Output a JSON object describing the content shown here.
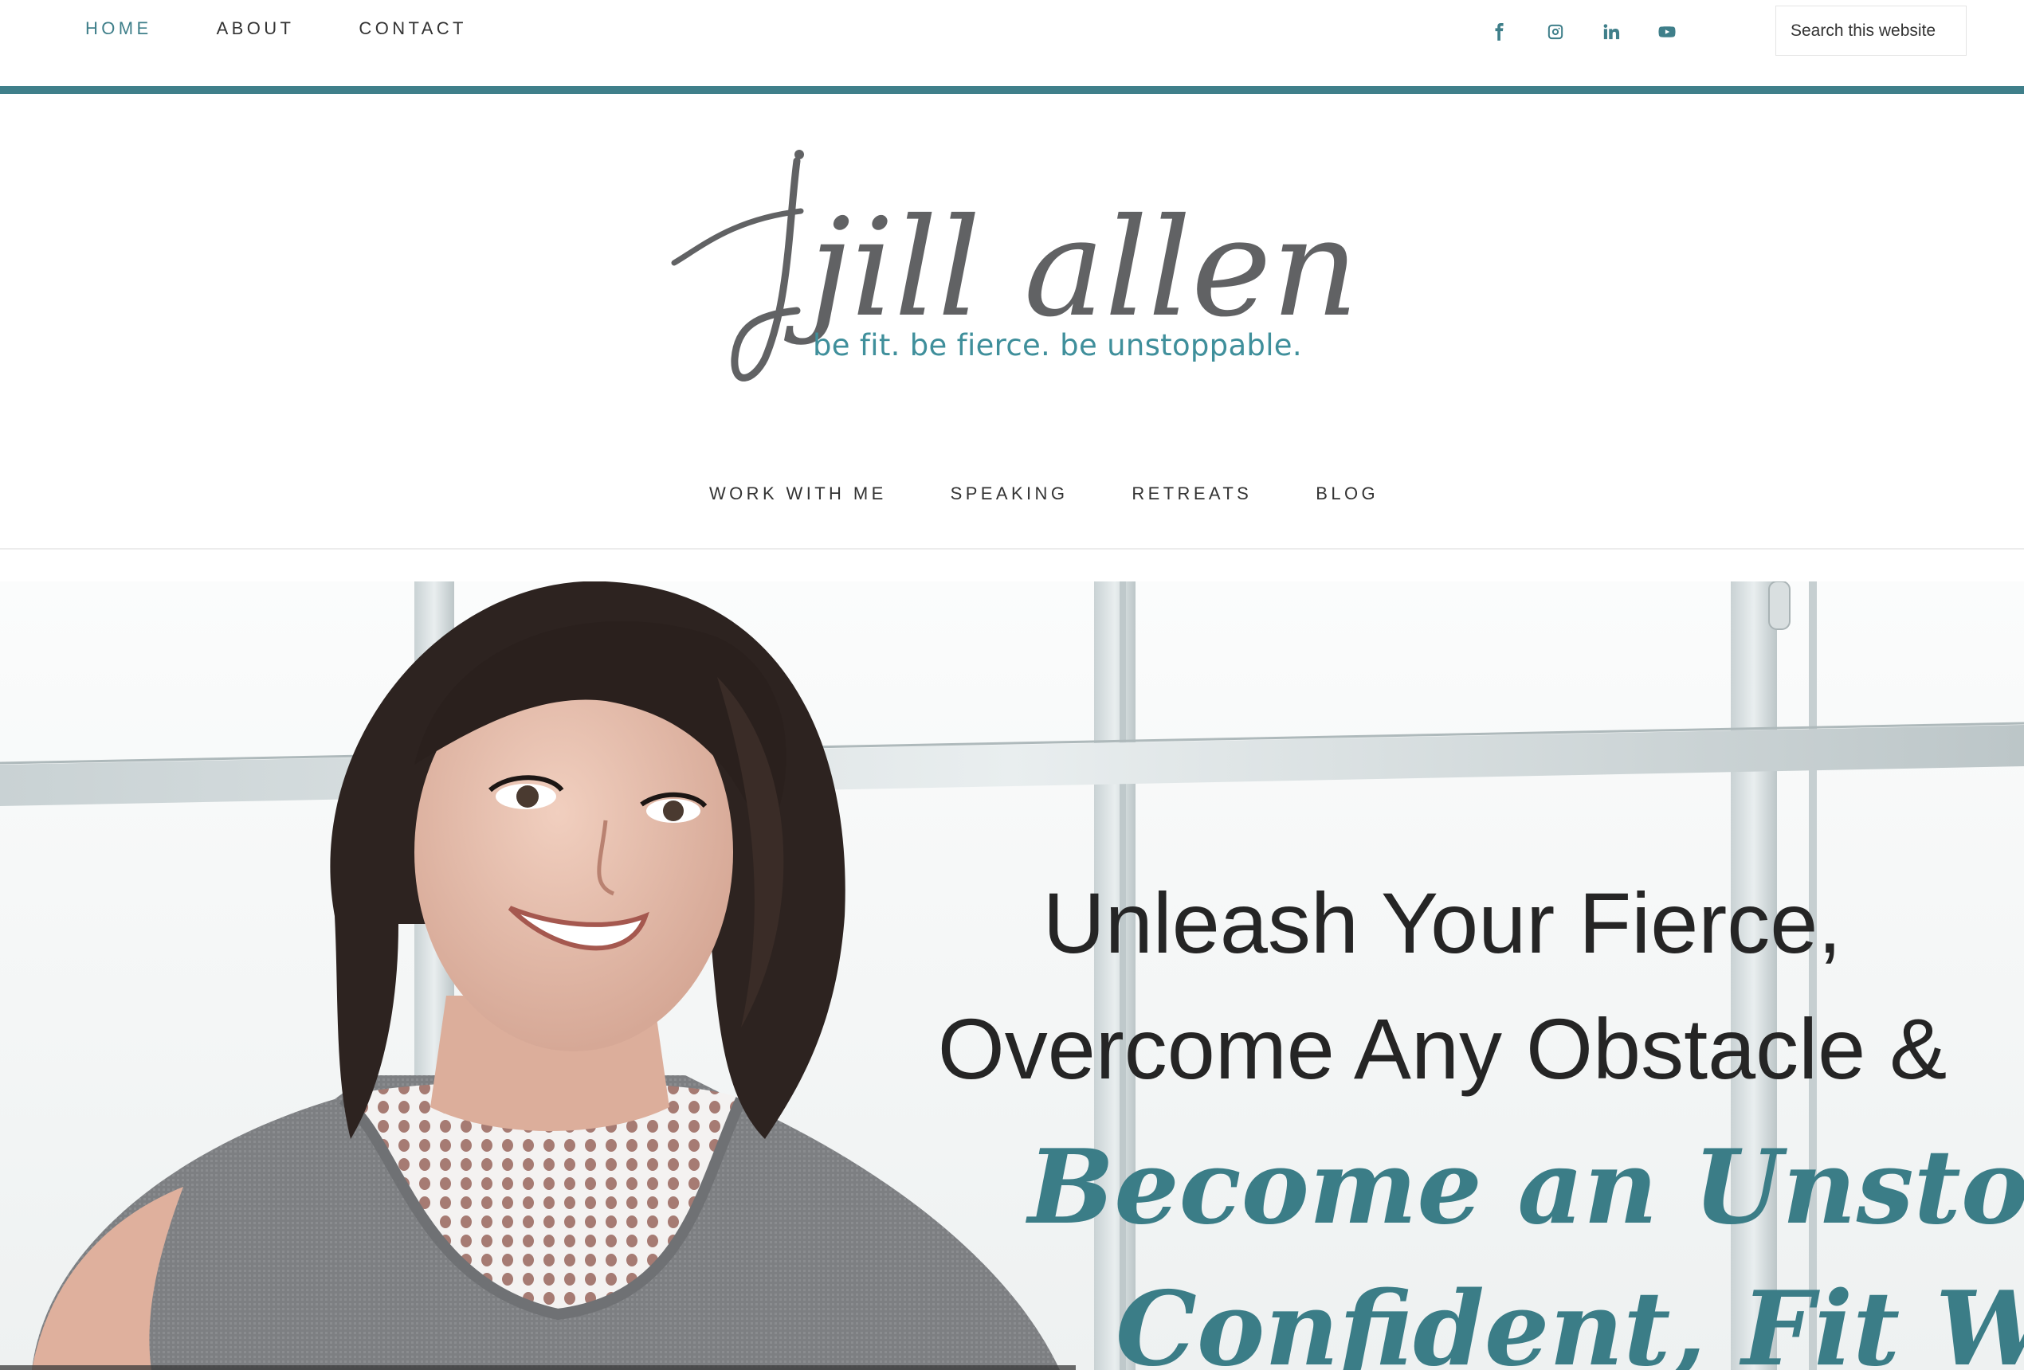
{
  "top_nav": {
    "items": [
      {
        "label": "HOME",
        "active": true
      },
      {
        "label": "ABOUT",
        "active": false
      },
      {
        "label": "CONTACT",
        "active": false
      }
    ]
  },
  "social": {
    "icons": [
      "facebook-icon",
      "instagram-icon",
      "linkedin-icon",
      "youtube-icon"
    ],
    "color": "#3f7f8a"
  },
  "search": {
    "placeholder": "Search this website",
    "value": ""
  },
  "logo": {
    "name": "jill allen",
    "tagline": "be fit. be fierce. be unstoppable."
  },
  "main_nav": {
    "items": [
      "WORK WITH ME",
      "SPEAKING",
      "RETREATS",
      "BLOG"
    ]
  },
  "hero": {
    "headline_line1": "Unleash Your Fierce,",
    "headline_line2": "Overcome Any Obstacle &",
    "script_line1": "Become an Unstoppable,",
    "script_line2": "Confident, Fit Woman"
  },
  "colors": {
    "accent": "#3f7f8a",
    "text": "#333333",
    "logo_gray": "#616264"
  }
}
